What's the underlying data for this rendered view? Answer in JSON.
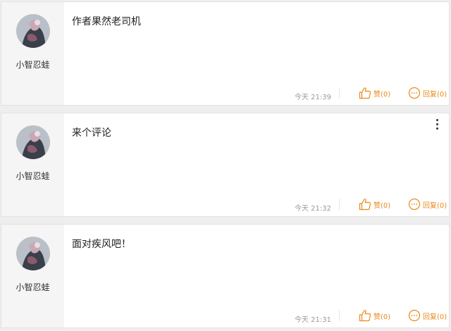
{
  "theme": {
    "accent": "#e8891c",
    "card_bg": "#ffffff",
    "author_bg": "#f5f5f5",
    "page_bg": "#eeeeee"
  },
  "comments": [
    {
      "username": "小智忍蛙",
      "text": "作者果然老司机",
      "time": "今天 21:39",
      "like_label": "赞(0)",
      "reply_label": "回复(0)",
      "avatar_icon": "avatar-icon",
      "show_more_menu": false
    },
    {
      "username": "小智忍蛙",
      "text": "来个评论",
      "time": "今天 21:32",
      "like_label": "赞(0)",
      "reply_label": "回复(0)",
      "avatar_icon": "avatar-icon",
      "show_more_menu": true
    },
    {
      "username": "小智忍蛙",
      "text": "面对疾风吧！",
      "time": "今天 21:31",
      "like_label": "赞(0)",
      "reply_label": "回复(0)",
      "avatar_icon": "avatar-icon",
      "show_more_menu": false
    }
  ]
}
